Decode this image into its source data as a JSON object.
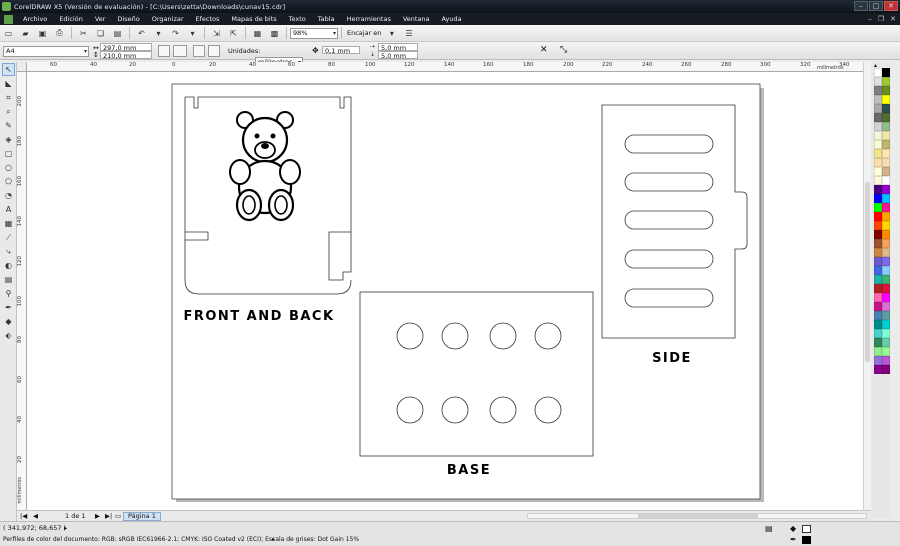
{
  "window": {
    "title": "CorelDRAW X5 (Versión de evaluación) - [C:\\Users\\zetta\\Downloads\\cunav15.cdr]"
  },
  "menu": [
    "Archivo",
    "Edición",
    "Ver",
    "Diseño",
    "Organizar",
    "Efectos",
    "Mapas de bits",
    "Texto",
    "Tabla",
    "Herramientas",
    "Ventana",
    "Ayuda"
  ],
  "toolbar": {
    "zoom": "98%",
    "snap_label": "Encajar en"
  },
  "property_bar": {
    "paper_size": "A4",
    "width": "297,0 mm",
    "height": "210,0 mm",
    "units_label": "Unidades:",
    "units_value": "milímetros",
    "nudge": "0,1 mm",
    "dup_x": "5,0 mm",
    "dup_y": "5,0 mm"
  },
  "rulers": {
    "top": [
      "60",
      "40",
      "20",
      "0",
      "20",
      "40",
      "60",
      "80",
      "100",
      "120",
      "140",
      "160",
      "180",
      "200",
      "220",
      "240",
      "260",
      "280",
      "300",
      "320",
      "340"
    ],
    "top_unit": "milímetros",
    "left": [
      "200",
      "180",
      "160",
      "140",
      "120",
      "100",
      "80",
      "60",
      "40",
      "20"
    ],
    "left_unit": "milímetros"
  },
  "drawing": {
    "label_front": "FRONT AND BACK",
    "label_side": "SIDE",
    "label_base": "BASE"
  },
  "page_nav": {
    "page_of": "1 de 1",
    "tab": "Página 1"
  },
  "status": {
    "coords": "( 341,972; 68,657 )",
    "profile": "Perfiles de color del documento: RGB: sRGB IEC61966-2.1; CMYK: ISO Coated v2 (ECI); Escala de grises: Dot Gain 15%"
  },
  "palette": [
    "#ffffff",
    "#000000",
    "#e0e0e0",
    "#9acd32",
    "#808080",
    "#6b8e23",
    "#c0c0c0",
    "#ffff00",
    "#a9a9a9",
    "#2f4f4f",
    "#696969",
    "#556b2f",
    "#d3d3d3",
    "#8fbc8f",
    "#f5f5dc",
    "#eee8aa",
    "#fafad2",
    "#bdb76b",
    "#f0e68c",
    "#ffe4b5",
    "#ffdead",
    "#f5deb3",
    "#ffffe0",
    "#d2b48c",
    "#fff8dc",
    "#ffffff",
    "#4b0082",
    "#9400d3",
    "#0000ff",
    "#00bfff",
    "#00ff00",
    "#ff1493",
    "#ff0000",
    "#ffa500",
    "#ff4500",
    "#ffd700",
    "#800000",
    "#ff8c00",
    "#a0522d",
    "#f4a460",
    "#cd853f",
    "#deb887",
    "#6a5acd",
    "#7b68ee",
    "#4169e1",
    "#87cefa",
    "#20b2aa",
    "#3cb371",
    "#b22222",
    "#dc143c",
    "#ff69b4",
    "#ff00ff",
    "#c71585",
    "#da70d6",
    "#4682b4",
    "#5f9ea0",
    "#008b8b",
    "#00ced1",
    "#48d1cc",
    "#7fffd4",
    "#2e8b57",
    "#66cdaa",
    "#90ee90",
    "#98fb98",
    "#9370db",
    "#ba55d3",
    "#8b008b",
    "#800080"
  ]
}
